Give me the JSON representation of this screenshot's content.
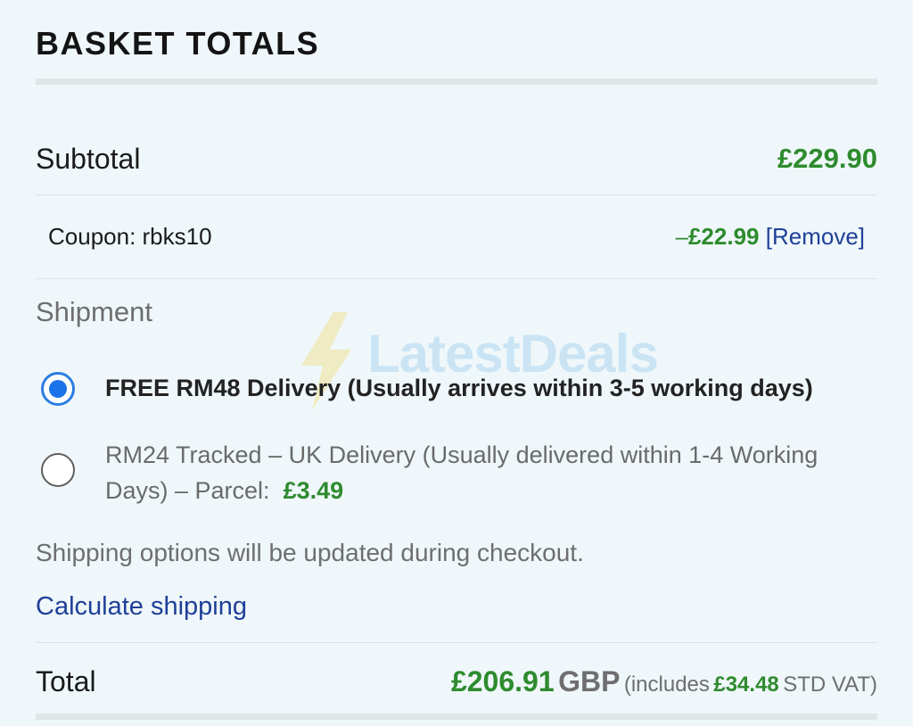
{
  "basket": {
    "title": "BASKET TOTALS",
    "subtotal": {
      "label": "Subtotal",
      "value": "£229.90"
    },
    "coupon": {
      "label": "Coupon: rbks10",
      "minus": "–",
      "amount": "£22.99",
      "remove_label": "[Remove]"
    },
    "shipment": {
      "heading": "Shipment",
      "options": [
        {
          "label": "FREE RM48 Delivery (Usually arrives within 3-5 working days)",
          "selected": true
        },
        {
          "label": "RM24 Tracked – UK Delivery (Usually delivered within 1-4 Working Days) – Parcel:",
          "price": "£3.49",
          "selected": false
        }
      ],
      "note": "Shipping options will be updated during checkout.",
      "calculate_label": "Calculate shipping"
    },
    "total": {
      "label": "Total",
      "amount": "£206.91",
      "currency": "GBP",
      "includes_prefix": "(includes",
      "vat_amount": "£34.48",
      "vat_suffix": "STD VAT)"
    }
  },
  "watermark": {
    "text": "LatestDeals",
    "icon": "lightning-bolt-icon"
  },
  "colors": {
    "accent_green": "#2e8b2e",
    "link_blue": "#1f3f98",
    "radio_blue": "#1a73e8",
    "background": "#eff7fa"
  }
}
